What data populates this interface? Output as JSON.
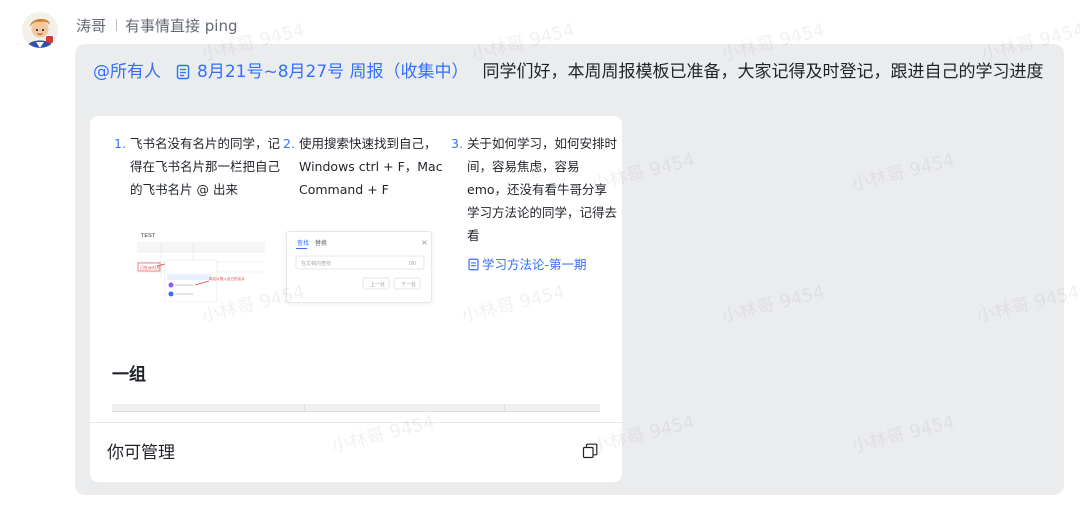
{
  "sender": {
    "name": "涛哥",
    "status": "有事情直接 ping"
  },
  "message": {
    "mention": "@所有人",
    "doc_link": "8月21号~8月27号 周报（收集中）",
    "text": "同学们好，本周周报模板已准备，大家记得及时登记，跟进自己的学习进度"
  },
  "card": {
    "columns": [
      {
        "num": "1.",
        "text": "飞书名没有名片的同学，记得在飞书名片那一栏把自己的飞书名片 @ 出来"
      },
      {
        "num": "2.",
        "text": "使用搜索快速找到自己，Windows ctrl + F，Mac Command + F"
      },
      {
        "num": "3.",
        "text": "关于如何学习，如何安排时间，容易焦虑，容易 emo，还没有看牛哥分享学习方法论的同学，记得去看",
        "link": "学习方法论-第一期"
      }
    ],
    "thumb1": {
      "title": "TEST",
      "note1": "已在@对方",
      "note2": "将名片拖入自己的名片"
    },
    "thumb2": {
      "tab_find": "查找",
      "tab_replace": "替换",
      "placeholder": "在文档内查找",
      "count": "0/0",
      "prev": "上一处",
      "next": "下一处"
    },
    "group_title": "一组",
    "footer_label": "你可管理"
  },
  "watermark": "小林哥 9454",
  "colors": {
    "accent": "#3370ff",
    "bubble": "#ebecee",
    "text": "#1f2329",
    "muted": "#646a73"
  }
}
